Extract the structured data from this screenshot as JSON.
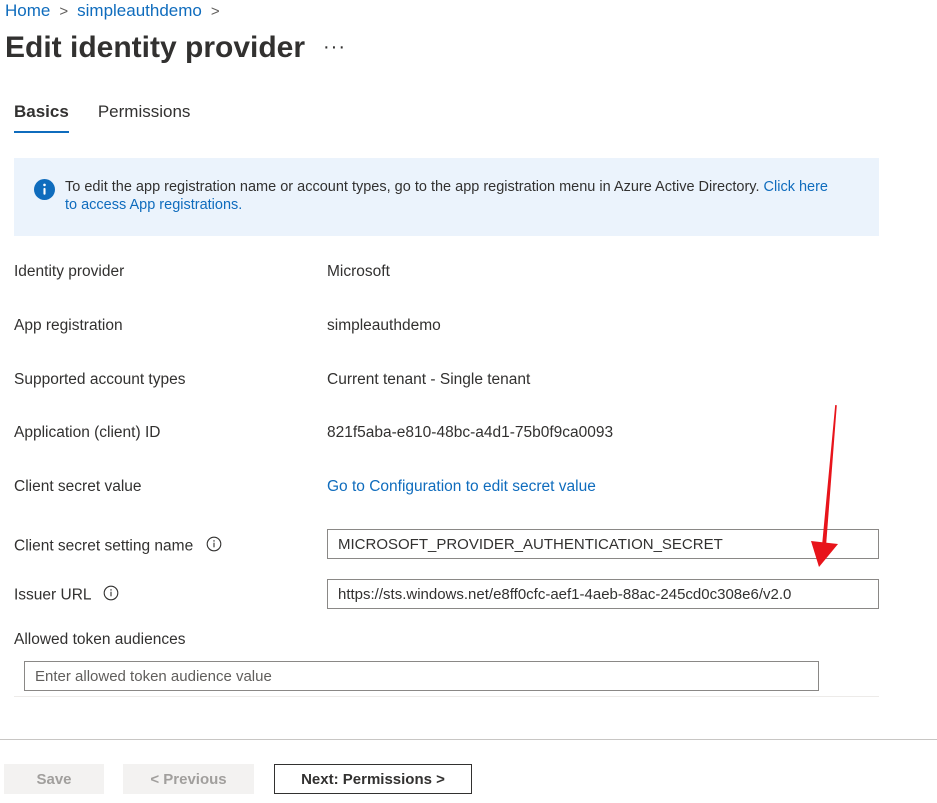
{
  "breadcrumb": {
    "home": "Home",
    "separator": ">",
    "current": "simpleauthdemo",
    "trailing": ">"
  },
  "page": {
    "title": "Edit identity provider",
    "more": "···"
  },
  "tabs": [
    {
      "label": "Basics",
      "active": true
    },
    {
      "label": "Permissions",
      "active": false
    }
  ],
  "info_banner": {
    "text": "To edit the app registration name or account types, go to the app registration menu in Azure Active Directory. ",
    "link": "Click here to access App registrations."
  },
  "fields": {
    "identity_provider": {
      "label": "Identity provider",
      "value": "Microsoft"
    },
    "app_registration": {
      "label": "App registration",
      "value": "simpleauthdemo"
    },
    "supported_account_types": {
      "label": "Supported account types",
      "value": "Current tenant - Single tenant"
    },
    "client_id": {
      "label": "Application (client) ID",
      "value": "821f5aba-e810-48bc-a4d1-75b0f9ca0093"
    },
    "client_secret_value": {
      "label": "Client secret value",
      "link": "Go to Configuration to edit secret value"
    },
    "client_secret_setting_name": {
      "label": "Client secret setting name",
      "value": "MICROSOFT_PROVIDER_AUTHENTICATION_SECRET"
    },
    "issuer_url": {
      "label": "Issuer URL",
      "value": "https://sts.windows.net/e8ff0cfc-aef1-4aeb-88ac-245cd0c308e6/v2.0"
    },
    "allowed_token_audiences": {
      "label": "Allowed token audiences",
      "placeholder": "Enter allowed token audience value",
      "value": ""
    }
  },
  "footer": {
    "save": "Save",
    "previous": "< Previous",
    "next": "Next: Permissions >"
  },
  "colors": {
    "accent": "#0f6cbd",
    "banner_bg": "#ebf3fc",
    "annotation_arrow": "#e8141b"
  },
  "icons": {
    "banner": "info-filled-icon",
    "field_info": "info-circle-icon",
    "annotation": "red-arrow-icon"
  }
}
